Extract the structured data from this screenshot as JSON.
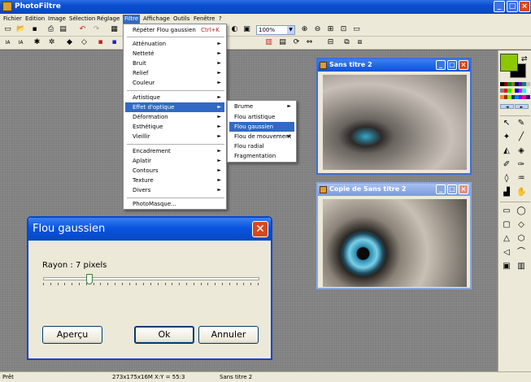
{
  "app": {
    "title": "PhotoFiltre"
  },
  "menubar": [
    "Fichier",
    "Edition",
    "Image",
    "Sélection",
    "Réglage",
    "Filtre",
    "Affichage",
    "Outils",
    "Fenêtre",
    "?"
  ],
  "toolbar": {
    "zoom": "100%",
    "icons_row1": [
      "new-icon",
      "open-icon",
      "save-icon",
      "print-icon",
      "scan-icon",
      "copy-icon",
      "undo-icon",
      "redo-icon"
    ],
    "icons_row2": [
      "auto-contrast-icon",
      "auto-level-icon",
      "magic-wand-icon",
      "brightness-icon"
    ]
  },
  "menu_filtre": {
    "repeat": "Répéter Flou gaussien",
    "repeat_shortcut": "Ctrl+K",
    "items": [
      "Atténuation",
      "Netteté",
      "Bruit",
      "Relief",
      "Couleur",
      "Artistique",
      "Effet d'optique",
      "Déformation",
      "Esthétique",
      "Vieillir",
      "Encadrement",
      "Aplatir",
      "Contours",
      "Texture",
      "Divers",
      "PhotoMasque..."
    ]
  },
  "submenu_optique": {
    "items": [
      "Brume",
      "Flou artistique",
      "Flou gaussien",
      "Flou de mouvement",
      "Flou radial",
      "Fragmentation"
    ]
  },
  "windows": {
    "win1_title": "Sans titre 2",
    "win2_title": "Copie de Sans titre 2"
  },
  "dialog": {
    "title": "Flou gaussien",
    "radius_label": "Rayon : 7 pixels",
    "radius_value": 7,
    "apercu": "Aperçu",
    "ok": "Ok",
    "annuler": "Annuler"
  },
  "status": {
    "state": "Prêt",
    "dims": "273x175x16M",
    "coords": "X:Y = 55:3",
    "doc": "Sans titre 2"
  },
  "colors": {
    "primary": "#8cc800",
    "secondary": "#000000",
    "menu_highlight": "#316ac5",
    "title_blue": "#0a4ed4"
  }
}
